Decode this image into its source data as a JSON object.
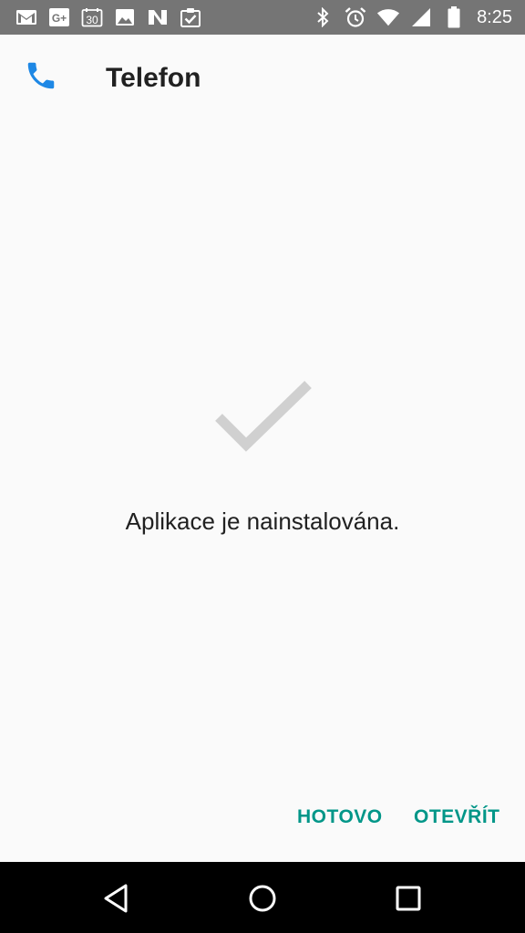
{
  "status_bar": {
    "time": "8:25",
    "g_plus_label": "G+",
    "calendar_day": "30",
    "left_icons": [
      "gmail-icon",
      "google-plus-icon",
      "calendar-icon",
      "photos-icon",
      "n-app-icon",
      "clipboard-check-icon"
    ],
    "right_icons": [
      "bluetooth-icon",
      "alarm-icon",
      "wifi-icon",
      "cell-signal-icon",
      "battery-icon"
    ]
  },
  "app": {
    "name": "Telefon",
    "icon": "phone-icon",
    "icon_color": "#1e88e5"
  },
  "result": {
    "icon": "checkmark-icon",
    "message": "Aplikace je nainstalována."
  },
  "actions": {
    "done_label": "HOTOVO",
    "open_label": "OTEVŘÍT",
    "accent_color": "#009688"
  },
  "nav": {
    "buttons": [
      "back-icon",
      "home-icon",
      "recents-icon"
    ]
  }
}
